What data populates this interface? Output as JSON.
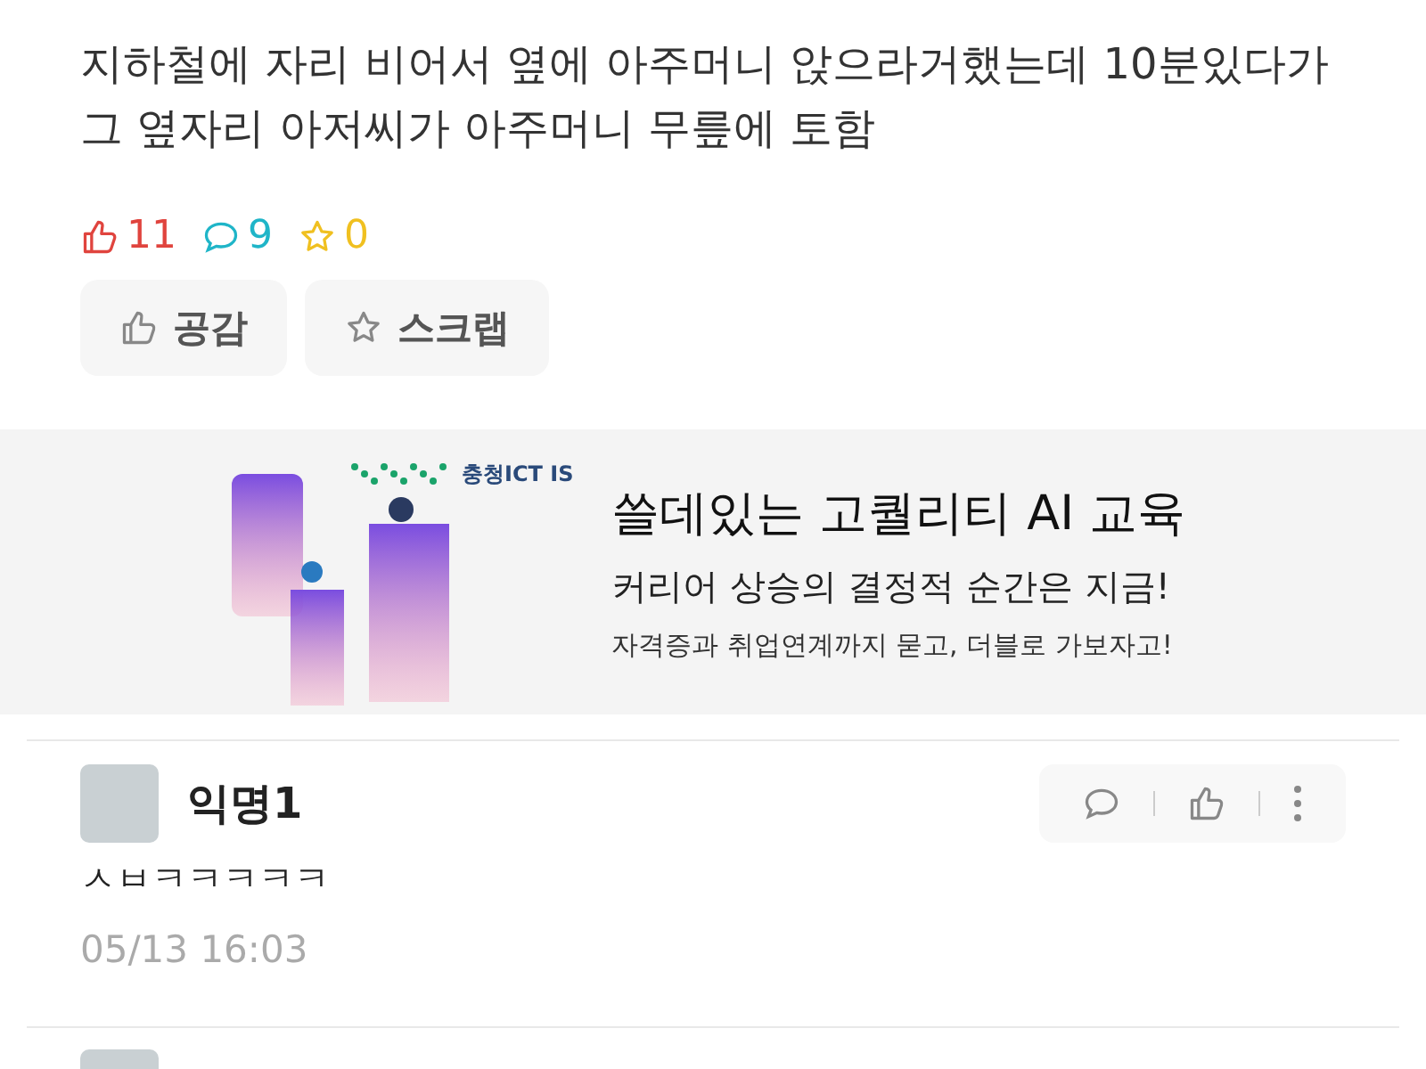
{
  "post": {
    "lines": [
      "지하철에 자리 비어서 옆에 아주머니 앉으라거했는데 10분있다가",
      "그 옆자리 아저씨가 아주머니 무릎에 토함"
    ]
  },
  "stats": {
    "likes": "11",
    "comments": "9",
    "scraps": "0"
  },
  "actions": [
    {
      "kind": "like",
      "label": "공감"
    },
    {
      "kind": "scrap",
      "label": "스크랩"
    }
  ],
  "banner": {
    "logo": "충청ICT IS",
    "headline": "쓸데있는 고퀄리티 AI 교육",
    "subhead": "커리어 상승의 결정적 순간은 지금!",
    "caption": "자격증과 취업연계까지 묻고, 더블로 가보자고!"
  },
  "comments": [
    {
      "author": "익명1",
      "text": "ㅅㅂㅋㅋㅋㅋㅋ",
      "time": "05/13 16:03"
    }
  ]
}
